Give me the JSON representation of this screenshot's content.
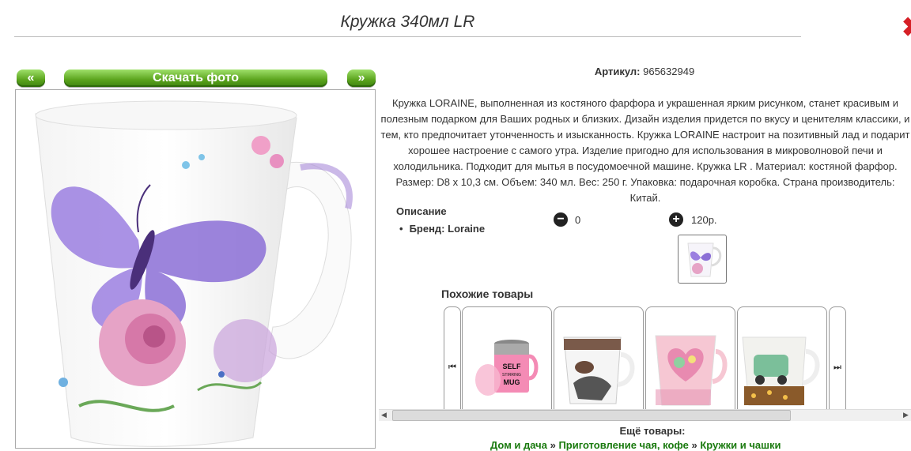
{
  "page": {
    "title": "Кружка 340мл LR"
  },
  "nav": {
    "prev_label": "«",
    "download_label": "Скачать фото",
    "next_label": "»"
  },
  "article": {
    "label": "Артикул:",
    "value": "965632949"
  },
  "description": "Кружка LORAINE, выполненная из костяного фарфора и украшенная ярким рисунком, станет красивым и полезным подарком для Ваших родных и близких. Дизайн изделия придется по вкусу и ценителям классики, и тем, кто предпочитает утонченность и изысканность. Кружка LORAINE настроит на позитивный лад и подарит хорошее настроение с самого утра. Изделие пригодно для использования в микроволновой печи и холодильника. Подходит для мытья в посудомоечной машине. Кружка LR . Материал: костяной фарфор. Размер: D8 x 10,3 см. Объем: 340 мл. Вес: 250 г. Упаковка: подарочная коробка. Страна производитель: Китай.",
  "specs": {
    "heading": "Описание",
    "brand": "Бренд: Loraine"
  },
  "qty": {
    "minus_value": "0",
    "plus_value": "120р."
  },
  "similar": {
    "heading": "Похожие товары"
  },
  "more": {
    "heading": "Ещё товары:"
  },
  "breadcrumbs": [
    "Дом и дача",
    "Приготовление чая, кофе",
    "Кружки и чашки"
  ],
  "breadcrumb_sep": "»",
  "colors": {
    "accent_green": "#5aa31c",
    "link_green": "#1a7a0f",
    "close_red": "#d61f26"
  }
}
